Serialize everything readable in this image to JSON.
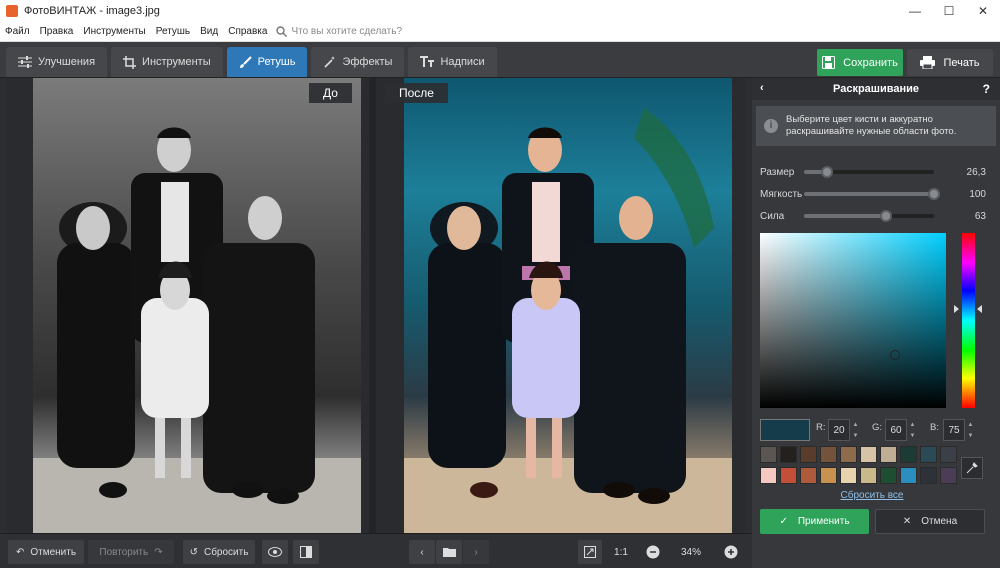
{
  "window": {
    "title": "ФотоВИНТАЖ - image3.jpg"
  },
  "menu": {
    "items": [
      "Файл",
      "Правка",
      "Инструменты",
      "Ретушь",
      "Вид",
      "Справка"
    ],
    "search_placeholder": "Что вы хотите сделать?"
  },
  "tabs": [
    {
      "label": "Улучшения",
      "icon": "sliders-icon",
      "active": false
    },
    {
      "label": "Инструменты",
      "icon": "crop-icon",
      "active": false
    },
    {
      "label": "Ретушь",
      "icon": "brush-icon",
      "active": true
    },
    {
      "label": "Эффекты",
      "icon": "magic-wand-icon",
      "active": false
    },
    {
      "label": "Надписи",
      "icon": "text-icon",
      "active": false
    }
  ],
  "actions": {
    "save": "Сохранить",
    "print": "Печать"
  },
  "view": {
    "before_label": "До",
    "after_label": "После"
  },
  "bottom": {
    "undo": "Отменить",
    "redo": "Повторить",
    "reset": "Сбросить",
    "ratio": "1:1",
    "zoom": "34%"
  },
  "panel": {
    "title": "Раскрашивание",
    "help": "?",
    "info": "Выберите цвет кисти и аккуратно раскрашивайте нужные области фото.",
    "sliders": [
      {
        "label": "Размер",
        "value": "26,3",
        "level": 0.18
      },
      {
        "label": "Мягкость",
        "value": "100",
        "level": 1.0
      },
      {
        "label": "Сила",
        "value": "63",
        "level": 0.63
      }
    ],
    "rgb": {
      "r_label": "R:",
      "r": "20",
      "g_label": "G:",
      "g": "60",
      "b_label": "B:",
      "b": "75"
    },
    "current_color": "#143c4b",
    "swatches": [
      "#5b5652",
      "#23201e",
      "#5a3c2a",
      "#73533c",
      "#8e6b4d",
      "#d7c3a6",
      "#bfae94",
      "#1c3b35",
      "#2a4a58",
      "#3a3f48",
      "#f4c9c2",
      "#c44f39",
      "#b05a3c",
      "#c7924f",
      "#e7d3ad",
      "#c9b889",
      "#1e4e32",
      "#2a8fbf",
      "#2e3138",
      "#4a3d55"
    ],
    "extra_swatches": [
      "#0f1216",
      "#c7c9f2"
    ],
    "reset_all": "Сбросить все",
    "apply": "Применить",
    "cancel": "Отмена"
  }
}
